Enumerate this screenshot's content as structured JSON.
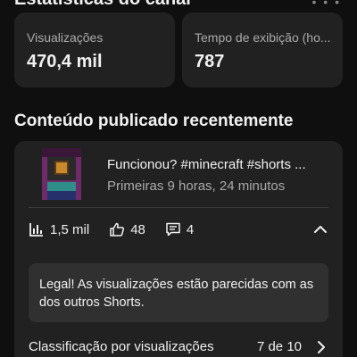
{
  "header": {
    "title": "Estatísticas do canal"
  },
  "stats": [
    {
      "label": "Visualizações",
      "value": "470,4 mil"
    },
    {
      "label": "Tempo de exibição (ho...",
      "value": "787"
    }
  ],
  "recent": {
    "section_title": "Conteúdo publicado recentemente",
    "video": {
      "title": "Funcionou? #minecraft #shorts ...",
      "subtitle": "Primeiras 9 horas, 24 minutos"
    },
    "metrics": {
      "views": "1,5 mil",
      "likes": "48",
      "comments": "4"
    },
    "insight": "Legal! As visualizações estão parecidas com as dos outros Shorts.",
    "ranking": {
      "label": "Classificação por visualizações",
      "value": "7 de 10"
    }
  }
}
